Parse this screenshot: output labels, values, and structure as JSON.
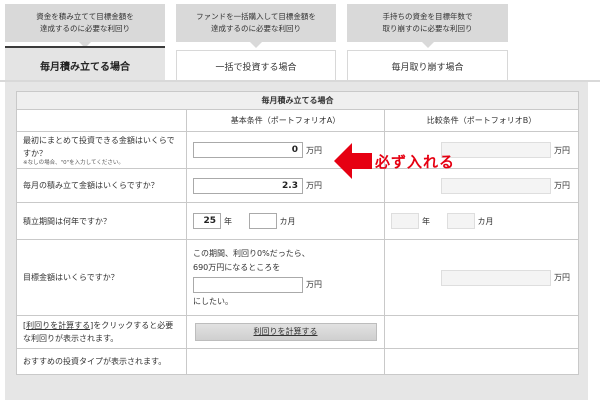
{
  "tabs": [
    {
      "description_lines": [
        "資金を積み立てて目標金額を",
        "達成するのに必要な利回り"
      ],
      "label": "毎月積み立てる場合",
      "active": true
    },
    {
      "description_lines": [
        "ファンドを一括購入して目標金額を",
        "達成するのに必要な利回り"
      ],
      "label": "一括で投資する場合",
      "active": false
    },
    {
      "description_lines": [
        "手持ちの資金を目標年数で",
        "取り崩すのに必要な利回り"
      ],
      "label": "毎月取り崩す場合",
      "active": false
    }
  ],
  "table": {
    "title": "毎月積み立てる場合",
    "col_a": "基本条件（ポートフォリオA）",
    "col_b": "比較条件（ポートフォリオB）",
    "rows": {
      "initial": {
        "question": "最初にまとめて投資できる金額はいくらですか？",
        "note": "※なしの場合、\"0\"を入力してください。",
        "value_a": "0",
        "value_b": "",
        "unit": "万円"
      },
      "monthly": {
        "question": "毎月の積み立て金額はいくらですか？",
        "value_a": "2.3",
        "value_b": "",
        "unit": "万円"
      },
      "period": {
        "question": "積立期間は何年ですか？",
        "years_a": "25",
        "months_a": "",
        "years_b": "",
        "months_b": "",
        "year_unit": "年",
        "month_unit": "カ月"
      },
      "target": {
        "question": "目標金額はいくらですか？",
        "hint_line1": "この期間、利回り0%だったら、",
        "hint_line2": "690万円になるところを",
        "value_a": "",
        "value_b": "",
        "unit": "万円",
        "suffix": "にしたい。"
      },
      "calc": {
        "link_text": "利回りを計算する",
        "instruction_a": "をクリックすると必",
        "instruction_b": "要な利回りが表示されます。",
        "button_label": "利回りを計算する"
      },
      "recommend": {
        "text": "おすすめの投資タイプが表示されます。"
      }
    }
  },
  "annotation": {
    "text": "必ず入れる",
    "color": "#e60012"
  }
}
